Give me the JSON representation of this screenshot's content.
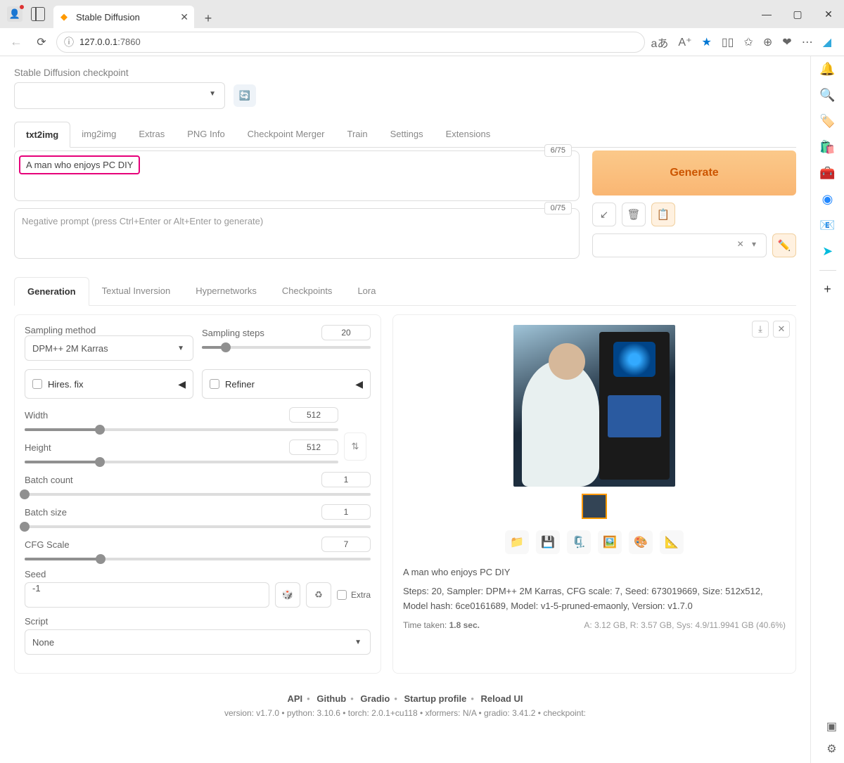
{
  "browser": {
    "tab_title": "Stable Diffusion",
    "url_host": "127.0.0.1",
    "url_port": ":7860"
  },
  "checkpoint": {
    "label": "Stable Diffusion checkpoint"
  },
  "main_tabs": [
    "txt2img",
    "img2img",
    "Extras",
    "PNG Info",
    "Checkpoint Merger",
    "Train",
    "Settings",
    "Extensions"
  ],
  "prompt": {
    "text": "A man who enjoys PC DIY",
    "tokens": "6/75"
  },
  "neg_prompt": {
    "placeholder": "Negative prompt (press Ctrl+Enter or Alt+Enter to generate)",
    "tokens": "0/75"
  },
  "generate_label": "Generate",
  "sub_tabs": [
    "Generation",
    "Textual Inversion",
    "Hypernetworks",
    "Checkpoints",
    "Lora"
  ],
  "sampling": {
    "method_label": "Sampling method",
    "method_value": "DPM++ 2M Karras",
    "steps_label": "Sampling steps",
    "steps_value": "20"
  },
  "hires_label": "Hires. fix",
  "refiner_label": "Refiner",
  "width": {
    "label": "Width",
    "value": "512"
  },
  "height": {
    "label": "Height",
    "value": "512"
  },
  "batch_count": {
    "label": "Batch count",
    "value": "1"
  },
  "batch_size": {
    "label": "Batch size",
    "value": "1"
  },
  "cfg": {
    "label": "CFG Scale",
    "value": "7"
  },
  "seed": {
    "label": "Seed",
    "value": "-1",
    "extra_label": "Extra"
  },
  "script": {
    "label": "Script",
    "value": "None"
  },
  "output": {
    "prompt_echo": "A man who enjoys PC DIY",
    "params": "Steps: 20, Sampler: DPM++ 2M Karras, CFG scale: 7, Seed: 673019669, Size: 512x512, Model hash: 6ce0161689, Model: v1-5-pruned-emaonly, Version: v1.7.0",
    "time_label": "Time taken: ",
    "time_value": "1.8 sec.",
    "mem": "A: 3.12 GB, R: 3.57 GB, Sys: 4.9/11.9941 GB (40.6%)"
  },
  "footer": {
    "links": [
      "API",
      "Github",
      "Gradio",
      "Startup profile",
      "Reload UI"
    ],
    "version_line": "version: v1.7.0  •  python: 3.10.6  •  torch: 2.0.1+cu118  •  xformers: N/A  •  gradio: 3.41.2  •  checkpoint:"
  }
}
